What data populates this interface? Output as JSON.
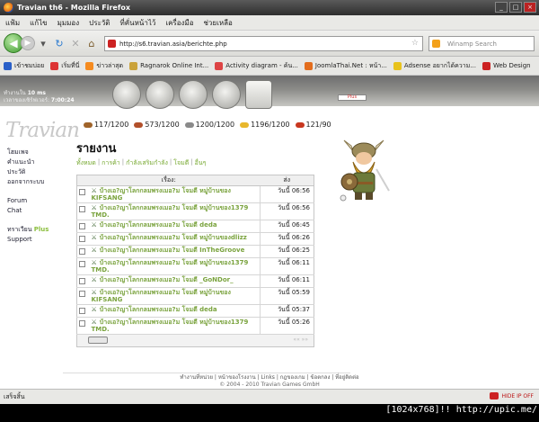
{
  "window": {
    "title": "Travian th6 - Mozilla Firefox",
    "buttons": [
      "_",
      "□",
      "×"
    ]
  },
  "menu": [
    "แฟ้ม",
    "แก้ไข",
    "มุมมอง",
    "ประวัติ",
    "ที่คั่นหน้าไว้",
    "เครื่องมือ",
    "ช่วยเหลือ"
  ],
  "nav": {
    "url": "http://s6.travian.asia/berichte.php",
    "search_placeholder": "Winamp Search"
  },
  "bookmarks": [
    {
      "label": "เข้าชมบ่อย",
      "color": "#2a60c8"
    },
    {
      "label": "เริ่มที่นี่",
      "color": "#d33"
    },
    {
      "label": "ข่าวล่าสุด",
      "color": "#f58b1f"
    },
    {
      "label": "Ragnarok Online Int...",
      "color": "#caa23a"
    },
    {
      "label": "Activity diagram - ค้น...",
      "color": "#d44"
    },
    {
      "label": "JoomlaThai.Net : หน้า...",
      "color": "#e36d1d"
    },
    {
      "label": "Adsense อยากได้ความ...",
      "color": "#e8c21b"
    },
    {
      "label": "Web Design",
      "color": "#c22"
    }
  ],
  "banner": {
    "line1_label": "ทำงานใน",
    "line1_value": "10 ms",
    "line2_label": "เวลาของเซิร์ฟเวอร์:",
    "line2_value": "7:00:24",
    "plus_badge": "Plus"
  },
  "logo_text": "Travian",
  "sidebar": {
    "links": [
      "โฮมเพจ",
      "คำแนะนำ",
      "ประวัติ",
      "ออกจากระบบ"
    ],
    "links2": [
      "Forum",
      "Chat"
    ],
    "plus_prefix": "ทราเวียน",
    "plus_word": "Plus",
    "support": "Support"
  },
  "resources": [
    {
      "value": "117/1200",
      "color": "#a0642a"
    },
    {
      "value": "573/1200",
      "color": "#b2502a"
    },
    {
      "value": "1200/1200",
      "color": "#8a8a8a"
    },
    {
      "value": "1196/1200",
      "color": "#e8b72c"
    },
    {
      "value": "121/90",
      "color": "#c8371f"
    }
  ],
  "heading": "รายงาน",
  "tabs": [
    "ทั้งหมด",
    "การค้า",
    "กำลังเสริมกำลัง",
    "โจมตี",
    "อื่นๆ"
  ],
  "table": {
    "col_subject": "เรื่อง:",
    "col_sent": "ส่ง",
    "rows": [
      {
        "subject": "บ้างเอ?ญาโลกกลมพรงเมอ?ม โจมตี หมู่บ้านของ KIFSANG",
        "when": "วันนี้ 06:56"
      },
      {
        "subject": "บ้างเอ?ญาโลกกลมพรงเมอ?ม โจมตี หมู่บ้านของ1379 TMD.",
        "when": "วันนี้ 06:56"
      },
      {
        "subject": "บ้างเอ?ญาโลกกลมพรงเมอ?ม โจมตี deda",
        "when": "วันนี้ 06:45"
      },
      {
        "subject": "บ้างเอ?ญาโลกกลมพรงเมอ?ม โจมตี หมู่บ้านของdlizz",
        "when": "วันนี้ 06:26"
      },
      {
        "subject": "บ้างเอ?ญาโลกกลมพรงเมอ?ม โจมตี InTheGroove",
        "when": "วันนี้ 06:25"
      },
      {
        "subject": "บ้างเอ?ญาโลกกลมพรงเมอ?ม โจมตี หมู่บ้านของ1379 TMD.",
        "when": "วันนี้ 06:11"
      },
      {
        "subject": "บ้างเอ?ญาโลกกลมพรงเมอ?ม โจมตี _GoNDor_",
        "when": "วันนี้ 06:11"
      },
      {
        "subject": "บ้างเอ?ญาโลกกลมพรงเมอ?ม โจมตี หมู่บ้านของ KIFSANG",
        "when": "วันนี้ 05:59"
      },
      {
        "subject": "บ้างเอ?ญาโลกกลมพรงเมอ?ม โจมตี deda",
        "when": "วันนี้ 05:37"
      },
      {
        "subject": "บ้างเอ?ญาโลกกลมพรงเมอ?ม โจมตี หมู่บ้านของ1379 TMD.",
        "when": "วันนี้ 05:26"
      }
    ],
    "pager": "«« »»"
  },
  "footer": {
    "links": "ทำงานที่หน่วย | หน้าของโรงงาน | Links | กฎของเกม | ข้อตกลง | ที่อยู่ติดต่อ",
    "copyright": "© 2004 - 2010 Travian Games GmbH"
  },
  "status": {
    "text": "เสร็จสิ้น",
    "hideip": "HIDE IP OFF"
  },
  "watermark": "[1024x768]!! http://upic.me/"
}
